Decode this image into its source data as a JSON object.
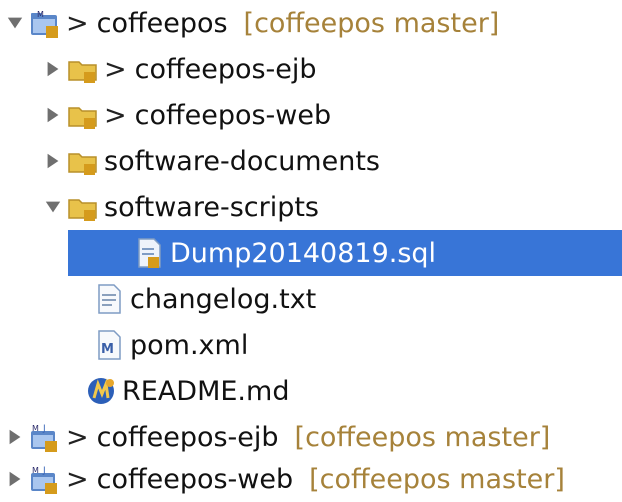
{
  "tree": {
    "items": [
      {
        "label": "coffeepos",
        "prefix": ">",
        "decoration": "[coffeepos master]",
        "expanded": true,
        "icon": "project-folder-icon"
      },
      {
        "label": "coffeepos-ejb",
        "prefix": ">",
        "expanded": false,
        "icon": "folder-icon"
      },
      {
        "label": "coffeepos-web",
        "prefix": ">",
        "expanded": false,
        "icon": "folder-icon"
      },
      {
        "label": "software-documents",
        "expanded": false,
        "icon": "folder-icon"
      },
      {
        "label": "software-scripts",
        "expanded": true,
        "icon": "folder-icon"
      },
      {
        "label": "Dump20140819.sql",
        "selected": true,
        "icon": "sql-file-icon"
      },
      {
        "label": "changelog.txt",
        "icon": "text-file-icon"
      },
      {
        "label": "pom.xml",
        "icon": "maven-pom-icon"
      },
      {
        "label": "README.md",
        "icon": "markdown-file-icon"
      },
      {
        "label": "coffeepos-ejb",
        "prefix": ">",
        "decoration": "[coffeepos master]",
        "expanded": false,
        "icon": "maven-project-icon"
      },
      {
        "label": "coffeepos-web",
        "prefix": ">",
        "decoration": "[coffeepos master]",
        "expanded": false,
        "icon": "maven-project-icon"
      }
    ]
  },
  "colors": {
    "selection": "#3875d7",
    "decoration": "#a6823a",
    "folder": "#e8c24a"
  }
}
